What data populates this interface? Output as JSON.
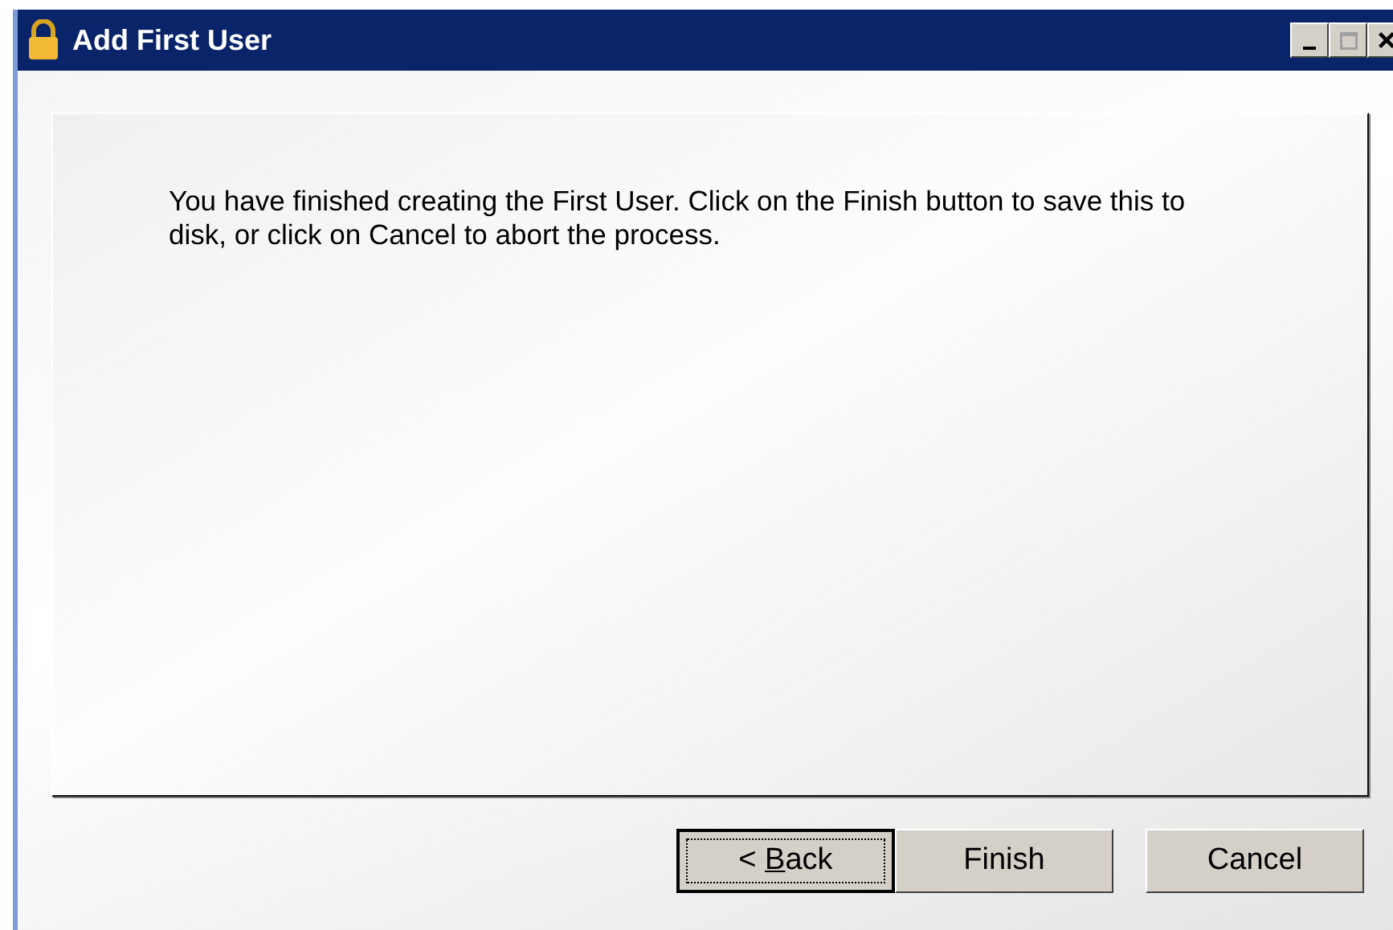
{
  "window": {
    "title": "Add First User",
    "controls": [
      {
        "kind": "minimize",
        "disabled": false
      },
      {
        "kind": "maximize",
        "disabled": true
      },
      {
        "kind": "close",
        "disabled": false
      }
    ]
  },
  "message": "You have finished creating the First User. Click on the Finish button to save this to disk, or click on Cancel to abort the process.",
  "buttons": [
    {
      "label": [
        {
          "text": "< "
        },
        {
          "text": "B",
          "underline": true
        },
        {
          "text": "ack"
        }
      ],
      "focused": true
    },
    {
      "label": [
        {
          "text": "Finish"
        }
      ],
      "focused": false
    },
    {
      "label": [
        {
          "text": "Cancel"
        }
      ],
      "focused": false
    }
  ]
}
